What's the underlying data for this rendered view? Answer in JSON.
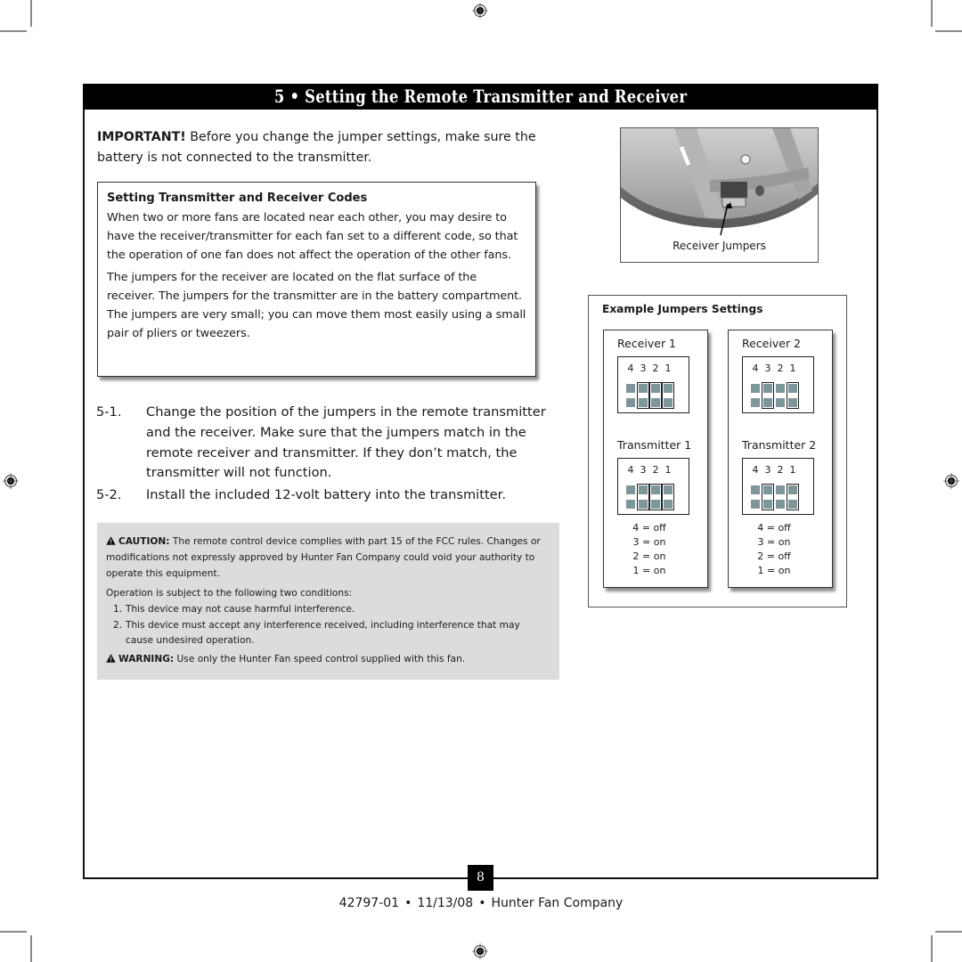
{
  "header": {
    "title": "5 • Setting the Remote Transmitter and Receiver"
  },
  "important": {
    "label": "IMPORTANT!",
    "text": " Before you change the jumper settings, make sure the battery is not connected to the transmitter."
  },
  "codes_box": {
    "heading": "Setting Transmitter and Receiver Codes",
    "paragraphs": [
      "When two or more fans are located near each other, you may desire to have the receiver/transmitter for each fan set to a different code, so that the operation of one fan does not affect the operation of the other fans.",
      "The jumpers for the receiver are located on the flat surface of the receiver. The jumpers for the transmitter are in the battery compartment. The jumpers are very small; you can move them most easily using a small pair of pliers or tweezers."
    ]
  },
  "steps": [
    {
      "num": "5-1.",
      "text": "Change the position of the jumpers in the remote transmitter and the receiver. Make sure that the jumpers match in the remote receiver and transmitter. If they don’t match, the transmitter will not function."
    },
    {
      "num": "5-2.",
      "text": "Install the included 12-volt battery into the transmitter."
    }
  ],
  "caution": {
    "caution_label": "CAUTION:",
    "caution_text": " The remote control device complies with part 15 of the FCC rules. Changes or modifications not expressly approved by Hunter Fan Company could void your authority to operate this equipment.",
    "conditions_intro": "Operation is subject to the following two conditions:",
    "conditions": [
      {
        "num": "1.",
        "text": "This device may not cause harmful interference."
      },
      {
        "num": "2.",
        "text": "This device must accept any interference received, including interference that may cause undesired operation."
      }
    ],
    "warning_label": "WARNING:",
    "warning_text": " Use only the Hunter Fan speed control supplied with this fan.",
    "icon": "warning-triangle-icon"
  },
  "photo": {
    "caption": "Receiver Jumpers"
  },
  "example": {
    "title": "Example Jumpers Settings",
    "columns": [
      {
        "receiver": {
          "label": "Receiver 1",
          "pins": [
            "4",
            "3",
            "2",
            "1"
          ],
          "on": [
            false,
            true,
            true,
            true
          ]
        },
        "transmitter": {
          "label": "Transmitter 1",
          "pins": [
            "4",
            "3",
            "2",
            "1"
          ],
          "on": [
            false,
            true,
            true,
            true
          ]
        },
        "settings": [
          "4 = off",
          "3 = on",
          "2 = on",
          "1 = on"
        ]
      },
      {
        "receiver": {
          "label": "Receiver 2",
          "pins": [
            "4",
            "3",
            "2",
            "1"
          ],
          "on": [
            false,
            true,
            false,
            true
          ]
        },
        "transmitter": {
          "label": "Transmitter 2",
          "pins": [
            "4",
            "3",
            "2",
            "1"
          ],
          "on": [
            false,
            true,
            false,
            true
          ]
        },
        "settings": [
          "4 = off",
          "3 = on",
          "2 = off",
          "1 = on"
        ]
      }
    ]
  },
  "footer": {
    "page_number": "8",
    "doc_number": "42797-01",
    "date": "11/13/08",
    "company": "Hunter Fan Company",
    "separator": "•"
  }
}
